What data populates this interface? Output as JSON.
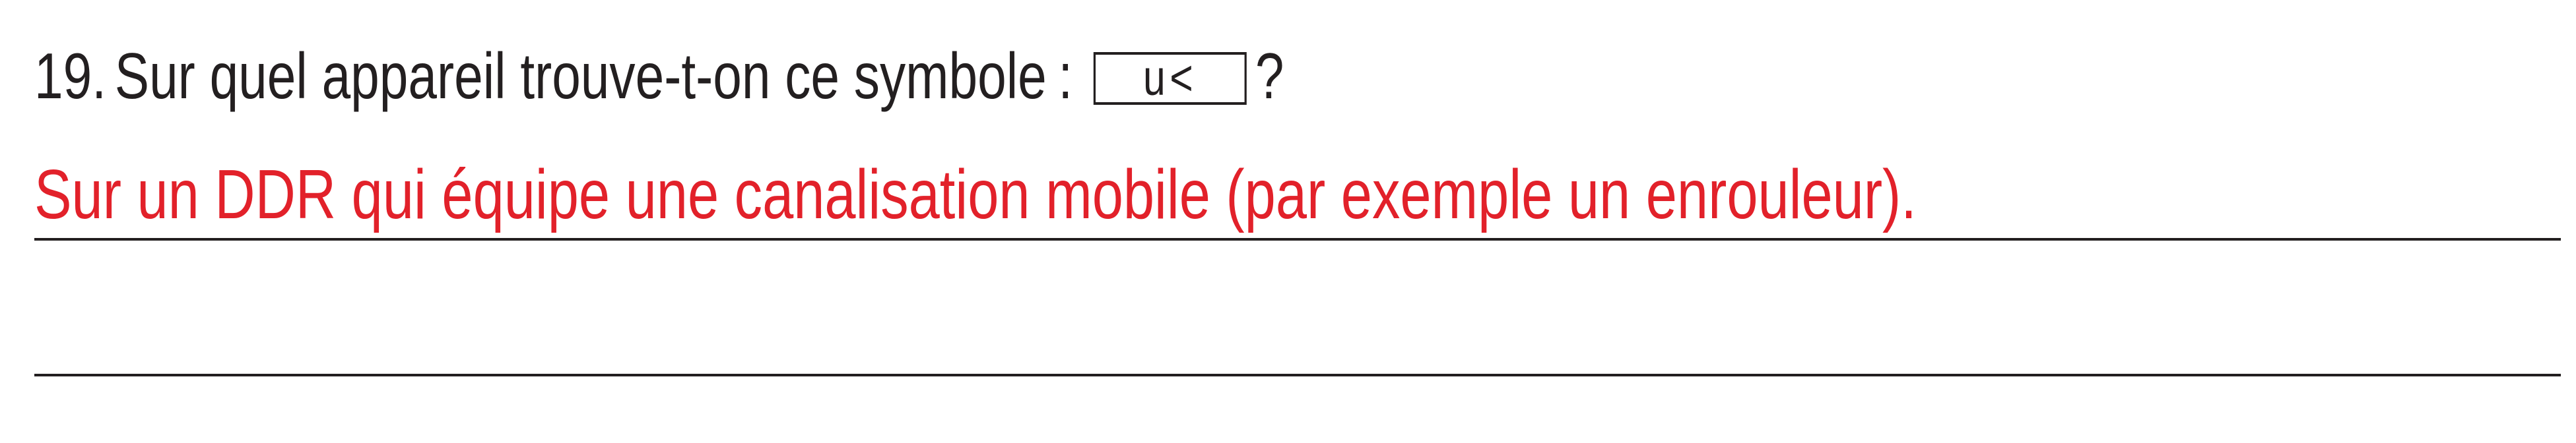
{
  "question": {
    "number": "19.",
    "text": "Sur quel appareil trouve-t-on ce symbole",
    "colon": ":",
    "symbol": "u<",
    "question_mark": "?"
  },
  "answer": {
    "text": "Sur un DDR qui équipe une canalisation mobile (par exemple un enrouleur)."
  },
  "colors": {
    "question_text": "#231f20",
    "answer_text": "#e2212a",
    "rule": "#231f20"
  }
}
